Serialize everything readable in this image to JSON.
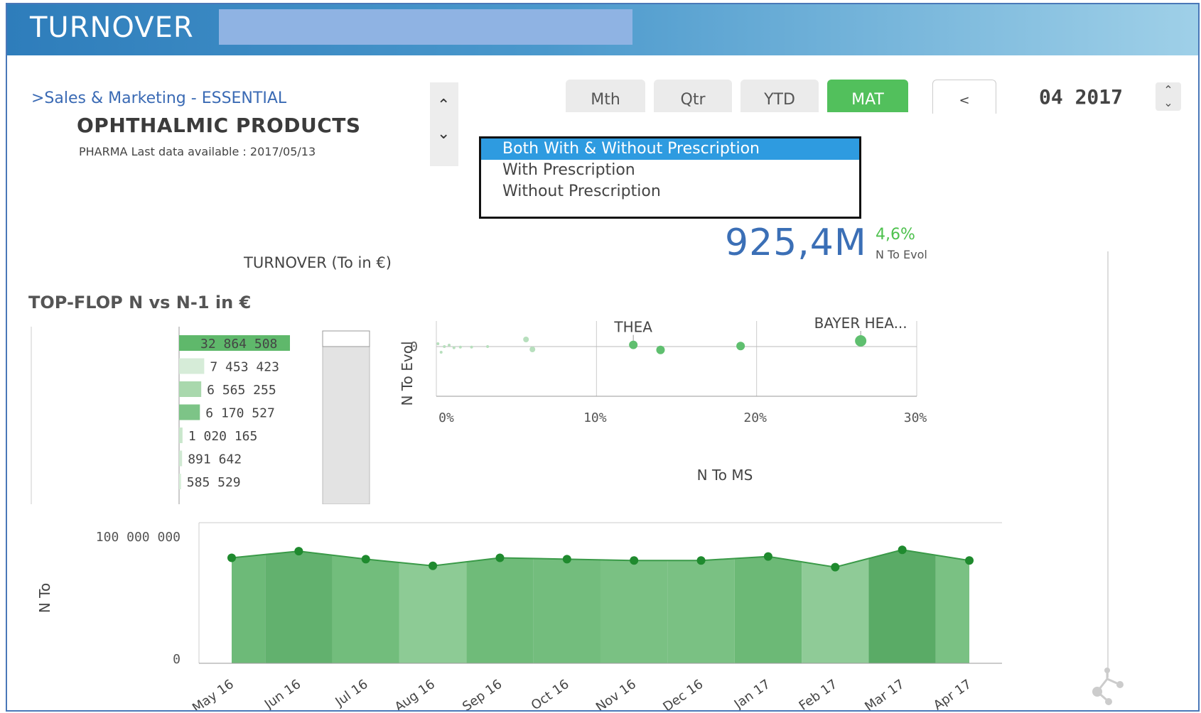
{
  "header": {
    "title": "TURNOVER"
  },
  "breadcrumb": ">Sales & Marketing - ESSENTIAL",
  "subtitle": "OPHTHALMIC PRODUCTS",
  "last_data": "PHARMA Last data available : 2017/05/13",
  "period_buttons": [
    {
      "label": "Mth",
      "active": false
    },
    {
      "label": "Qtr",
      "active": false
    },
    {
      "label": "YTD",
      "active": false
    },
    {
      "label": "MAT",
      "active": true
    }
  ],
  "nav_prev_label": "<",
  "period_value": "04 2017",
  "prescription_filter": {
    "options": [
      "Both With & Without Prescription",
      "With Prescription",
      "Without Prescription"
    ],
    "selected_index": 0
  },
  "kpi": {
    "value": "925,4M",
    "evol": "4,6%",
    "label": "N To Evol"
  },
  "turnover_label": "TURNOVER (To in €)",
  "topflop_title": "TOP-FLOP N vs N-1 in €",
  "colors": {
    "accent_green": "#52c05c",
    "kpi_blue": "#3b6fb6",
    "header_blue": "#2e7dbb"
  },
  "chart_data": [
    {
      "type": "bar",
      "orientation": "horizontal",
      "value_labels": [
        "32 864 508",
        "7 453 423",
        "6 565 255",
        "6 170 527",
        "1 020 165",
        "891 642",
        "585 529"
      ],
      "values": [
        32864508,
        7453423,
        6565255,
        6170527,
        1020165,
        891642,
        585529
      ]
    },
    {
      "type": "scatter",
      "xlabel": "N To MS",
      "ylabel": "N To Evol",
      "x_ticks": [
        "0%",
        "10%",
        "20%",
        "30%"
      ],
      "y_ticks": [
        "0"
      ],
      "xlim": [
        0,
        0.3
      ],
      "annotations": [
        "THEA",
        "BAYER HEA..."
      ],
      "points": [
        {
          "x": 0.001,
          "y": 0.01
        },
        {
          "x": 0.003,
          "y": -0.02
        },
        {
          "x": 0.005,
          "y": 0.0
        },
        {
          "x": 0.008,
          "y": 0.005
        },
        {
          "x": 0.011,
          "y": -0.004
        },
        {
          "x": 0.015,
          "y": -0.002
        },
        {
          "x": 0.022,
          "y": -0.002
        },
        {
          "x": 0.032,
          "y": 0.0
        },
        {
          "x": 0.056,
          "y": 0.025
        },
        {
          "x": 0.06,
          "y": -0.01
        },
        {
          "x": 0.123,
          "y": 0.006,
          "label": "THEA"
        },
        {
          "x": 0.14,
          "y": -0.012
        },
        {
          "x": 0.19,
          "y": 0.002
        },
        {
          "x": 0.265,
          "y": 0.02,
          "label": "BAYER HEA..."
        }
      ]
    },
    {
      "type": "area",
      "ylabel": "N To",
      "y_ticks": [
        "100 000 000",
        "0"
      ],
      "ylim": [
        0,
        100000000
      ],
      "categories": [
        "May 16",
        "Jun 16",
        "Jul 16",
        "Aug 16",
        "Sep 16",
        "Oct 16",
        "Nov 16",
        "Dec 16",
        "Jan 17",
        "Feb 17",
        "Mar 17",
        "Apr 17"
      ],
      "values": [
        79000000,
        84000000,
        78000000,
        73000000,
        79000000,
        78000000,
        77000000,
        77000000,
        80000000,
        72000000,
        85000000,
        77000000
      ]
    }
  ]
}
